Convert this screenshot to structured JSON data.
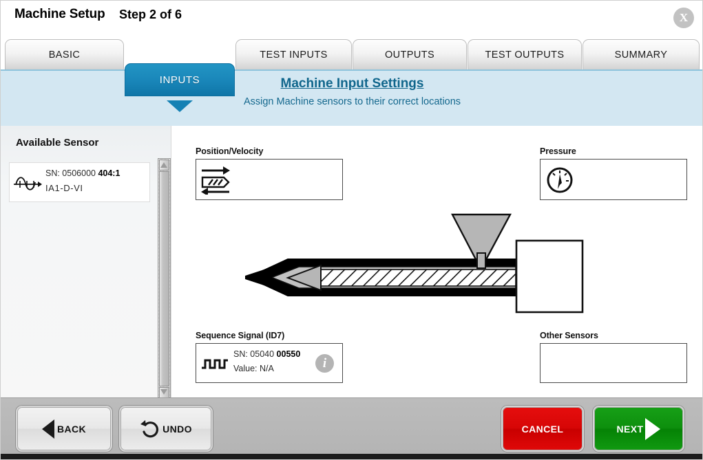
{
  "window": {
    "title": "Machine Setup",
    "step": "Step 2 of 6",
    "close_icon": "close-x-icon",
    "close_label": "X"
  },
  "tabs": [
    {
      "label": "BASIC",
      "active": false
    },
    {
      "label": "INPUTS",
      "active": true
    },
    {
      "label": "TEST INPUTS",
      "active": false
    },
    {
      "label": "OUTPUTS",
      "active": false
    },
    {
      "label": "TEST OUTPUTS",
      "active": false
    },
    {
      "label": "SUMMARY",
      "active": false
    }
  ],
  "banner": {
    "title": "Machine Input Settings",
    "subtitle": "Assign Machine sensors to their correct locations"
  },
  "sidebar": {
    "title": "Available Sensor",
    "sensor": {
      "icon": "sine-wave-sensor-icon",
      "sn_prefix": "SN: 0506000 ",
      "sn_bold": "404:1",
      "id": "IA1-D-VI"
    },
    "scrollbar": {
      "up_icon": "scroll-up-arrow-icon",
      "down_icon": "scroll-down-arrow-icon"
    }
  },
  "slots": {
    "position_velocity": {
      "label": "Position/Velocity",
      "icon": "position-velocity-arrows-icon"
    },
    "pressure": {
      "label": "Pressure",
      "icon": "pressure-gauge-icon"
    },
    "sequence_signal": {
      "label": "Sequence Signal (ID7)",
      "icon": "square-wave-pulse-icon",
      "sn_prefix": "SN: 05040 ",
      "sn_bold": "00550",
      "value": "Value: N/A",
      "info_icon": "info-icon",
      "info_label": "i"
    },
    "other_sensors": {
      "label": "Other Sensors"
    }
  },
  "diagram": {
    "name": "injection-molding-machine-diagram"
  },
  "footer": {
    "back": {
      "label": "BACK",
      "icon": "left-triangle-icon"
    },
    "undo": {
      "label": "UNDO",
      "icon": "undo-arrow-icon"
    },
    "cancel": {
      "label": "CANCEL"
    },
    "next": {
      "label": "NEXT",
      "icon": "right-triangle-icon"
    }
  },
  "colors": {
    "accent_blue": "#1a87ba",
    "banner_bg": "#d3e7f2",
    "banner_text": "#10668c",
    "cancel_red": "#d70606",
    "next_green": "#0d8f0d",
    "footer_grey": "#b4b4b4"
  }
}
